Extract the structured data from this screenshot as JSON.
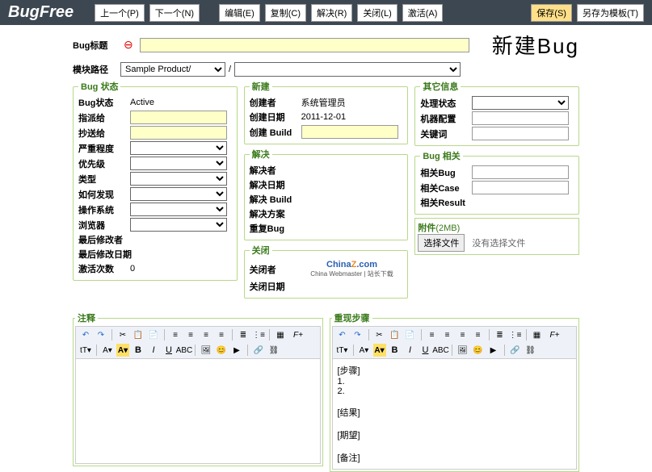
{
  "header": {
    "logo": "BugFree",
    "buttons": {
      "prev": "上一个(P)",
      "next": "下一个(N)",
      "edit": "编辑(E)",
      "copy": "复制(C)",
      "resolve": "解决(R)",
      "close": "关闭(L)",
      "activate": "激活(A)",
      "save": "保存(S)",
      "saveas": "另存为模板(T)"
    }
  },
  "title": {
    "label": "Bug标题",
    "big": "新建Bug"
  },
  "module": {
    "label": "模块路径",
    "product": "Sample Product/",
    "slash": "/"
  },
  "status": {
    "legend": "Bug 状态",
    "fields": {
      "status": "Bug状态",
      "status_val": "Active",
      "assign": "指派给",
      "cc": "抄送给",
      "severity": "严重程度",
      "priority": "优先级",
      "type": "类型",
      "howfound": "如何发现",
      "os": "操作系统",
      "browser": "浏览器",
      "lastmod": "最后修改者",
      "lastmoddate": "最后修改日期",
      "activations": "激活次数",
      "activations_val": "0"
    }
  },
  "create": {
    "legend": "新建",
    "creator": "创建者",
    "creator_val": "系统管理员",
    "date": "创建日期",
    "date_val": "2011-12-01",
    "build": "创建 Build"
  },
  "resolve": {
    "legend": "解决",
    "resolver": "解决者",
    "date": "解决日期",
    "build": "解决 Build",
    "solution": "解决方案",
    "dup": "重复Bug"
  },
  "closesec": {
    "legend": "关闭",
    "closer": "关闭者",
    "date": "关闭日期"
  },
  "other": {
    "legend": "其它信息",
    "pstatus": "处理状态",
    "machine": "机器配置",
    "keyword": "关键词"
  },
  "related": {
    "legend": "Bug 相关",
    "bug": "相关Bug",
    "case": "相关Case",
    "result": "相关Result"
  },
  "attach": {
    "legend": "附件",
    "size": "(2MB)",
    "btn": "选择文件",
    "none": "没有选择文件"
  },
  "watermark": {
    "main": "ChinaZ.com",
    "sub": "China Webmaster | 站长下载"
  },
  "editor": {
    "note": "注释",
    "repro": "重现步骤",
    "repro_content": "[步骤]\n1.\n2.\n\n[结果]\n\n[期望]\n\n[备注]"
  }
}
